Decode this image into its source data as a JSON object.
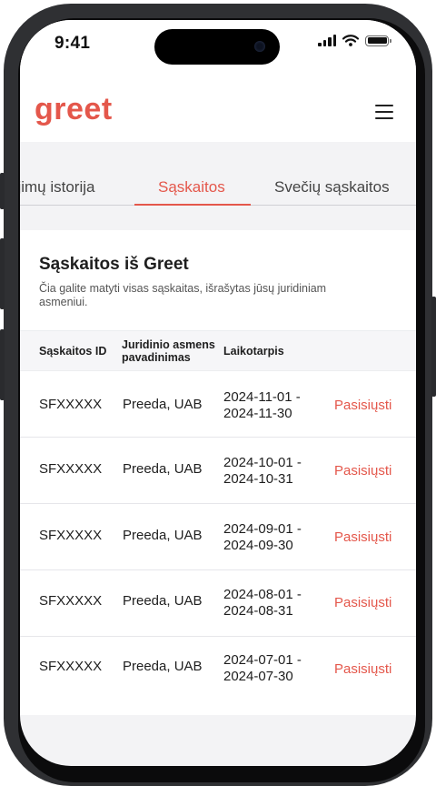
{
  "status_bar": {
    "time": "9:41"
  },
  "header": {
    "logo": "greet",
    "menu_icon": "hamburger-menu-icon"
  },
  "tabs": [
    {
      "label": "ėjimų istorija",
      "active": false
    },
    {
      "label": "Sąskaitos",
      "active": true
    },
    {
      "label": "Svečių sąskaitos",
      "active": false
    }
  ],
  "section": {
    "title": "Sąskaitos iš Greet",
    "description": "Čia galite matyti visas sąskaitas, išrašytas jūsų juridiniam asmeniui."
  },
  "table": {
    "columns": {
      "id": "Sąskaitos ID",
      "name": "Juridinio asmens pavadinimas",
      "period": "Laikotarpis"
    },
    "rows": [
      {
        "id": "SFXXXXX",
        "name": "Preeda, UAB",
        "period_start": "2024-11-01 -",
        "period_end": "2024-11-30",
        "action": "Pasisiųsti"
      },
      {
        "id": "SFXXXXX",
        "name": "Preeda, UAB",
        "period_start": "2024-10-01 -",
        "period_end": "2024-10-31",
        "action": "Pasisiųsti"
      },
      {
        "id": "SFXXXXX",
        "name": "Preeda, UAB",
        "period_start": "2024-09-01 -",
        "period_end": "2024-09-30",
        "action": "Pasisiųsti"
      },
      {
        "id": "SFXXXXX",
        "name": "Preeda, UAB",
        "period_start": "2024-08-01 -",
        "period_end": "2024-08-31",
        "action": "Pasisiųsti"
      },
      {
        "id": "SFXXXXX",
        "name": "Preeda, UAB",
        "period_start": "2024-07-01 -",
        "period_end": "2024-07-30",
        "action": "Pasisiųsti"
      }
    ]
  },
  "colors": {
    "accent": "#e4574b",
    "text": "#1e1e1e",
    "background": "#f3f3f5"
  }
}
